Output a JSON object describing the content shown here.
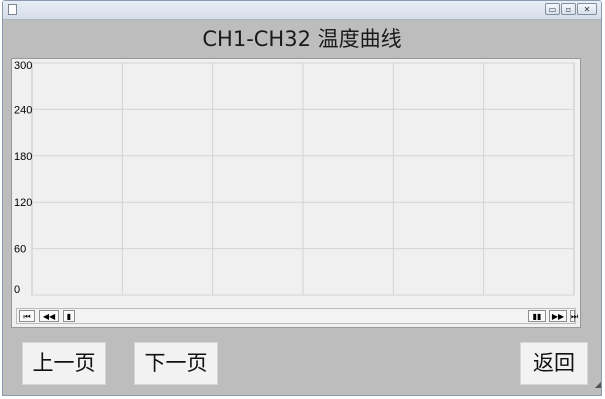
{
  "window": {
    "controls": {
      "minimize": "▭",
      "maximize": "▫",
      "close": "✕"
    }
  },
  "page": {
    "title": "CH1-CH32  温度曲线"
  },
  "chart_data": {
    "type": "line",
    "title": "",
    "xlabel": "",
    "ylabel": "",
    "ylim": [
      0,
      300
    ],
    "yticks": [
      "300",
      "240",
      "180",
      "120",
      "60",
      "0"
    ],
    "x_gridlines": 6,
    "grid": true,
    "series": []
  },
  "scroll_controls": {
    "first": "⏮",
    "prev": "◀◀",
    "thumb": "▮",
    "pause": "▮▮",
    "next": "▶▶",
    "last": "⏭"
  },
  "buttons": {
    "prev_page": "上一页",
    "next_page": "下一页",
    "back": "返回"
  },
  "colors": {
    "window_bg": "#bdbdbd",
    "plot_bg": "#f0f0f0",
    "grid": "#d4d4d4"
  }
}
